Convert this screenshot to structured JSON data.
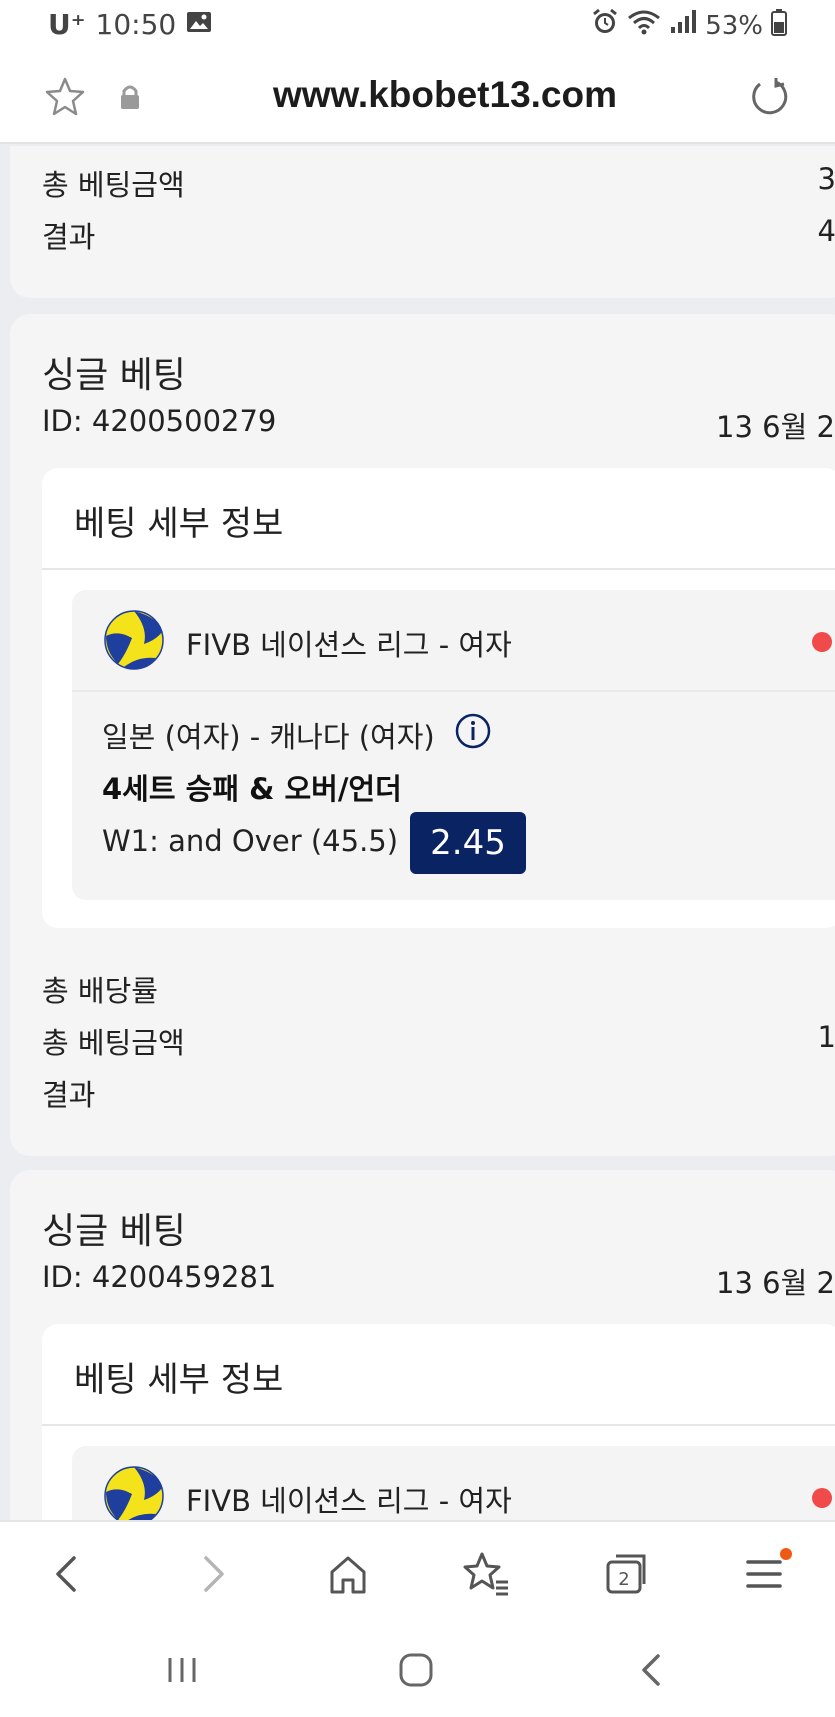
{
  "status_bar": {
    "carrier": "U⁺",
    "time": "10:50",
    "battery": "53%",
    "icons": [
      "image-icon",
      "alarm-icon",
      "wifi-icon",
      "signal-icon",
      "battery-icon"
    ]
  },
  "address_bar": {
    "url": "www.kbobet13.com",
    "icons": [
      "star-icon",
      "lock-icon",
      "reload-icon"
    ]
  },
  "top_card": {
    "total_stake_label": "총 베팅금액",
    "total_stake_value": "3",
    "result_label": "결과",
    "result_value": "4"
  },
  "bets": [
    {
      "title": "싱글 베팅",
      "id": "ID: 4200500279",
      "date": "13 6월 2",
      "details_title": "베팅 세부 정보",
      "league": "FIVB 네이션스 리그 - 여자",
      "match": "일본 (여자) - 캐나다 (여자)",
      "market": "4세트 승패 & 오버/언더",
      "selection": "W1: and Over (45.5)",
      "odds": "2.45",
      "total_odds_label": "총 배당률",
      "total_stake_label": "총 베팅금액",
      "total_stake_value": "1",
      "result_label": "결과"
    },
    {
      "title": "싱글 베팅",
      "id": "ID: 4200459281",
      "date": "13 6월 2",
      "details_title": "베팅 세부 정보",
      "league": "FIVB 네이션스 리그 - 여자"
    }
  ],
  "toolbar": {
    "buttons": [
      "back-icon",
      "forward-icon",
      "home-icon",
      "bookmarks-icon",
      "tabs-icon",
      "menu-icon"
    ],
    "tab_count": "2"
  },
  "colors": {
    "odds_badge": "#0a2463",
    "live_dot": "#f04a4a",
    "menu_badge": "#ee5a14",
    "card_bg": "#f5f5f6",
    "page_bg": "#ebedf0"
  }
}
